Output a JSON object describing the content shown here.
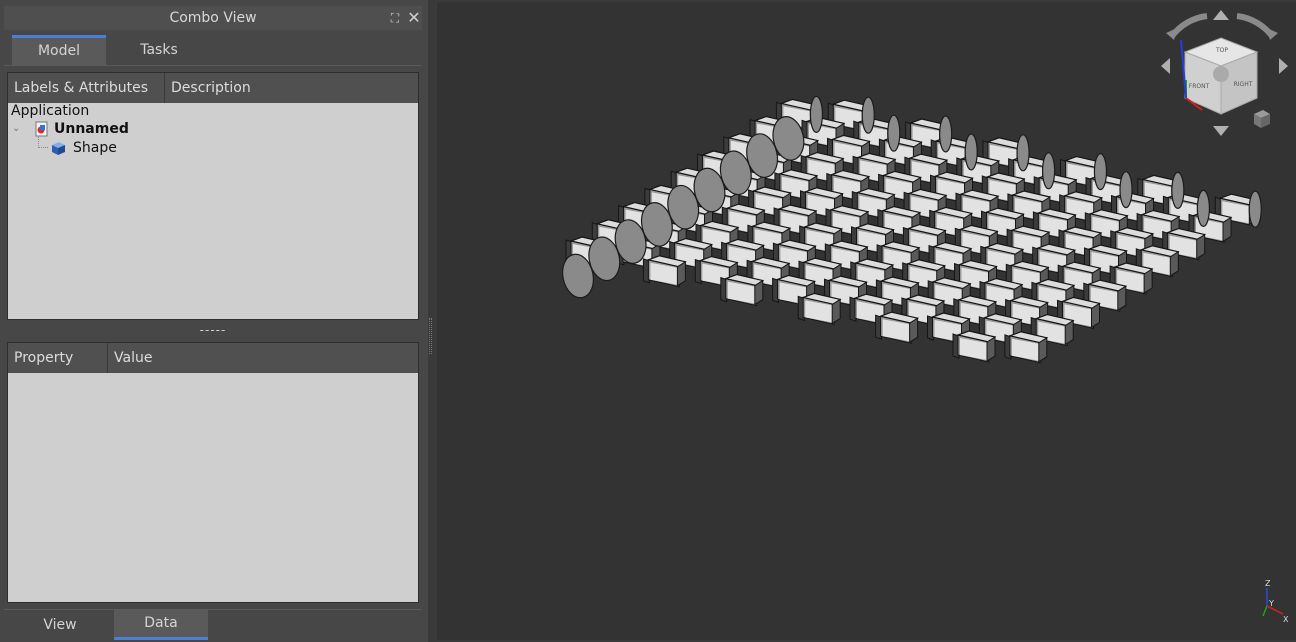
{
  "combo_view": {
    "title": "Combo View",
    "tabs": [
      {
        "label": "Model",
        "active": true
      },
      {
        "label": "Tasks",
        "active": false
      }
    ],
    "tree": {
      "columns": [
        "Labels & Attributes",
        "Description"
      ],
      "root_label": "Application",
      "document": {
        "label": "Unnamed",
        "icon": "document-icon"
      },
      "children": [
        {
          "label": "Shape",
          "icon": "part-cube-icon"
        }
      ]
    },
    "splitter_handle": "-----",
    "property_view": {
      "columns": [
        "Property",
        "Value"
      ]
    },
    "bottom_tabs": [
      {
        "label": "View",
        "active": false
      },
      {
        "label": "Data",
        "active": true
      }
    ]
  },
  "viewport": {
    "background": "#333333",
    "model": "honeycomb-shape",
    "navigation_cube": {
      "faces": [
        "FRONT",
        "RIGHT",
        "TOP"
      ]
    },
    "axis_labels": [
      "Z",
      "Y",
      "X"
    ]
  },
  "colors": {
    "accent": "#4a7fd6",
    "panel_bg": "#cfcfcf",
    "header_bg": "#505050"
  }
}
